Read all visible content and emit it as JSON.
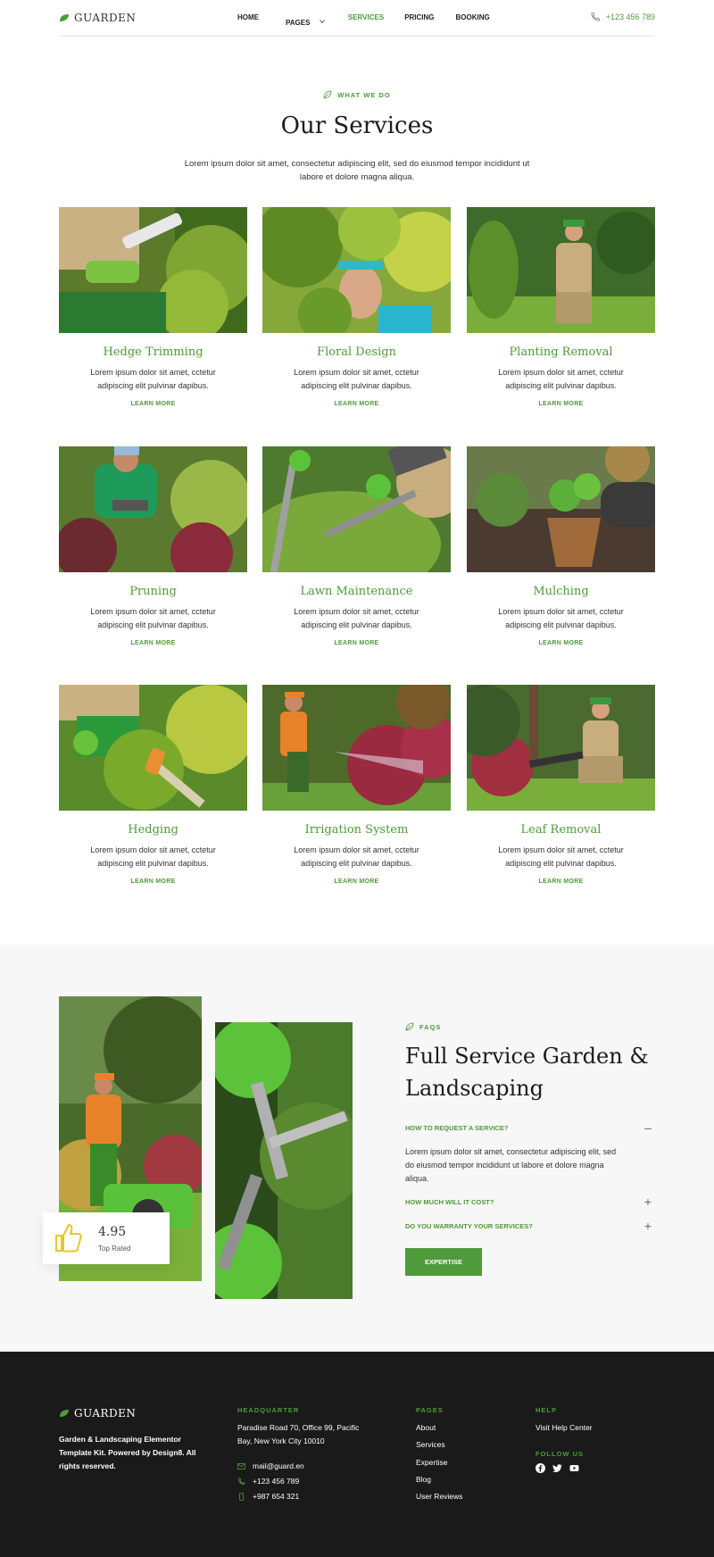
{
  "header": {
    "brand": "GUARDEN",
    "nav": [
      {
        "label": "HOME",
        "active": false
      },
      {
        "label": "PAGES",
        "active": false,
        "dropdown": true
      },
      {
        "label": "SERVICES",
        "active": true
      },
      {
        "label": "PRICING",
        "active": false
      },
      {
        "label": "BOOKING",
        "active": false
      }
    ],
    "phone": "+123 456 789"
  },
  "services": {
    "eyebrow": "WHAT WE DO",
    "title": "Our Services",
    "lead": "Lorem ipsum dolor sit amet, consectetur adipiscing elit, sed do eiusmod tempor incididunt ut labore et dolore magna aliqua.",
    "cards": [
      {
        "title": "Hedge Trimming",
        "desc": "Lorem ipsum dolor sit amet, cctetur adipiscing elit pulvinar dapibus.",
        "link": "LEARN MORE"
      },
      {
        "title": "Floral Design",
        "desc": "Lorem ipsum dolor sit amet, cctetur adipiscing elit pulvinar dapibus.",
        "link": "LEARN MORE"
      },
      {
        "title": "Planting Removal",
        "desc": "Lorem ipsum dolor sit amet, cctetur adipiscing elit pulvinar dapibus.",
        "link": "LEARN MORE"
      },
      {
        "title": "Pruning",
        "desc": "Lorem ipsum dolor sit amet, cctetur adipiscing elit pulvinar dapibus.",
        "link": "LEARN MORE"
      },
      {
        "title": "Lawn Maintenance",
        "desc": "Lorem ipsum dolor sit amet, cctetur adipiscing elit pulvinar dapibus.",
        "link": "LEARN MORE"
      },
      {
        "title": "Mulching",
        "desc": "Lorem ipsum dolor sit amet, cctetur adipiscing elit pulvinar dapibus.",
        "link": "LEARN MORE"
      },
      {
        "title": "Hedging",
        "desc": "Lorem ipsum dolor sit amet, cctetur adipiscing elit pulvinar dapibus.",
        "link": "LEARN MORE"
      },
      {
        "title": "Irrigation System",
        "desc": "Lorem ipsum dolor sit amet, cctetur adipiscing elit pulvinar dapibus.",
        "link": "LEARN MORE"
      },
      {
        "title": "Leaf Removal",
        "desc": "Lorem ipsum dolor sit amet, cctetur adipiscing elit pulvinar dapibus.",
        "link": "LEARN MORE"
      }
    ]
  },
  "faq": {
    "eyebrow": "FAQS",
    "title": "Full Service Garden & Landscaping",
    "rating": {
      "score": "4.95",
      "label": "Top Rated"
    },
    "items": [
      {
        "q": "HOW TO REQUEST A SERVICE?",
        "open": true,
        "a": "Lorem ipsum dolor sit amet, consectetur adipiscing elit, sed do eiusmod tempor incididunt ut labore et dolore magna aliqua."
      },
      {
        "q": "HOW MUCH WILL IT COST?",
        "open": false
      },
      {
        "q": "DO YOU WARRANTY YOUR SERVICES?",
        "open": false
      }
    ],
    "button": "EXPERTISE"
  },
  "footer": {
    "brand": "GUARDEN",
    "about": "Garden & Landscaping Elementor Template Kit. Powered by Design8. All rights reserved.",
    "hq_heading": "HEADQUARTER",
    "address": "Paradise Road 70, Office 99, Pacific Bay,  New York City 10010",
    "email": "mail@guard.en",
    "phone": "+123 456 789",
    "mobile": "+987 654 321",
    "pages_heading": "PAGES",
    "pages": [
      "About",
      "Services",
      "Expertise",
      "Blog",
      "User Reviews"
    ],
    "help_heading": "HELP",
    "help_link": "Visit Help Center",
    "follow_heading": "FOLLOW US"
  },
  "colors": {
    "accent": "#4f9a3a",
    "footer_bg": "#1a1a1a",
    "band_bg": "#f7f7f7"
  }
}
